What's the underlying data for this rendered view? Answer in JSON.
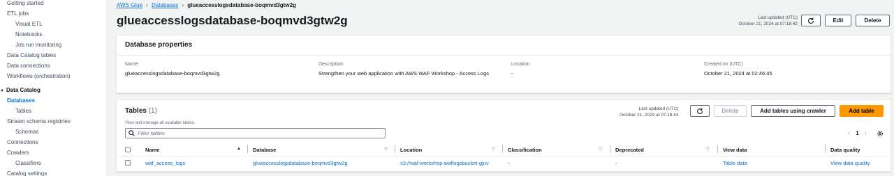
{
  "sidebar": {
    "items": [
      {
        "label": "Getting started"
      },
      {
        "label": "ETL jobs"
      },
      {
        "label": "Visual ETL"
      },
      {
        "label": "Notebooks"
      },
      {
        "label": "Job run monitoring"
      },
      {
        "label": "Data Catalog tables"
      },
      {
        "label": "Data connections"
      },
      {
        "label": "Workflows (orchestration)"
      },
      {
        "label": "Data Catalog"
      },
      {
        "label": "Databases"
      },
      {
        "label": "Tables"
      },
      {
        "label": "Stream schema registries"
      },
      {
        "label": "Schemas"
      },
      {
        "label": "Connections"
      },
      {
        "label": "Crawlers"
      },
      {
        "label": "Classifiers"
      },
      {
        "label": "Catalog settings"
      }
    ]
  },
  "breadcrumb": {
    "items": [
      "AWS Glue",
      "Databases",
      "glueaccesslogsdatabase-boqmvd3gtw2g"
    ]
  },
  "header": {
    "title": "glueaccesslogsdatabase-boqmvd3gtw2g",
    "updated_label": "Last updated (UTC)",
    "updated_time": "October 21, 2024 at 07:18:42",
    "edit_label": "Edit",
    "delete_label": "Delete"
  },
  "properties": {
    "title": "Database properties",
    "name_label": "Name",
    "name_value": "glueaccesslogsdatabase-boqmvd3gtw2g",
    "description_label": "Description",
    "description_value": "Strengthen your web application with AWS WAF Workshop - Access Logs",
    "location_label": "Location",
    "location_value": "-",
    "created_label": "Created on (UTC)",
    "created_value": "October 21, 2024 at 02:46:45"
  },
  "tables": {
    "title": "Tables",
    "count": "(1)",
    "description": "View and manage all available tables.",
    "updated_label": "Last updated (UTC)",
    "updated_time": "October 21, 2024 at 07:18:44",
    "delete_label": "Delete",
    "crawler_label": "Add tables using crawler",
    "add_label": "Add table",
    "filter_placeholder": "Filter tables",
    "page": "1",
    "columns": [
      "Name",
      "Database",
      "Location",
      "Classification",
      "Deprecated",
      "View data",
      "Data quality"
    ],
    "rows": [
      {
        "name": "waf_access_logs",
        "database": "glueaccesslogsdatabase-boqmvd3gtw2g",
        "location": "s3://waf-workshop-waflogsbucket-gjuv",
        "classification": "-",
        "deprecated": "-",
        "view_data": "Table data",
        "data_quality": "View data quality"
      }
    ]
  },
  "colors": {
    "link": "#0972d3",
    "primary": "#ff9900",
    "background": "#f2f3f3"
  }
}
